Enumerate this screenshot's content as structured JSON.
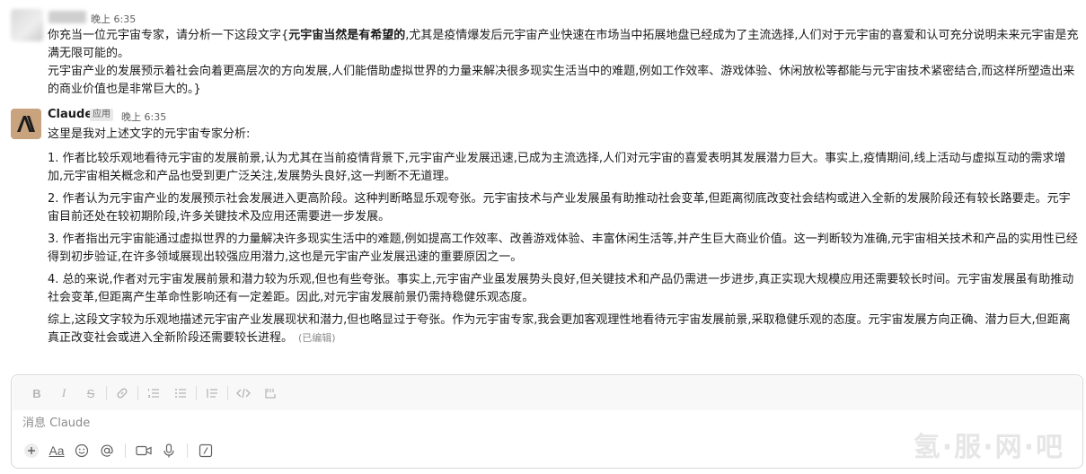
{
  "user_message": {
    "time": "晚上 6:35",
    "lines_intro": "你充当一位元宇宙专家，请分析一下这段文字{",
    "lines_bold": "元宇宙当然是有希望的",
    "lines_rest": ",尤其是疫情爆发后元宇宙产业快速在市场当中拓展地盘已经成为了主流选择,人们对于元宇宙的喜爱和认可充分说明未来元宇宙是充满无限可能的。",
    "paragraph2": "元宇宙产业的发展预示着社会向着更高层次的方向发展,人们能借助虚拟世界的力量来解决很多现实生活当中的难题,例如工作效率、游戏体验、休闲放松等都能与元宇宙技术紧密结合,而这样所塑造出来的商业价值也是非常巨大的。}"
  },
  "claude_message": {
    "author": "Claude",
    "badge": "应用",
    "time": "晚上 6:35",
    "intro": "这里是我对上述文字的元宇宙专家分析:",
    "points": [
      "1. 作者比较乐观地看待元宇宙的发展前景,认为尤其在当前疫情背景下,元宇宙产业发展迅速,已成为主流选择,人们对元宇宙的喜爱表明其发展潜力巨大。事实上,疫情期间,线上活动与虚拟互动的需求增加,元宇宙相关概念和产品也受到更广泛关注,发展势头良好,这一判断不无道理。",
      "2. 作者认为元宇宙产业的发展预示社会发展进入更高阶段。这种判断略显乐观夸张。元宇宙技术与产业发展虽有助推动社会变革,但距离彻底改变社会结构或进入全新的发展阶段还有较长路要走。元宇宙目前还处在较初期阶段,许多关键技术及应用还需要进一步发展。",
      "3. 作者指出元宇宙能通过虚拟世界的力量解决许多现实生活中的难题,例如提高工作效率、改善游戏体验、丰富休闲生活等,并产生巨大商业价值。这一判断较为准确,元宇宙相关技术和产品的实用性已经得到初步验证,在许多领域展现出较强应用潜力,这也是元宇宙产业发展迅速的重要原因之一。",
      "4. 总的来说,作者对元宇宙发展前景和潜力较为乐观,但也有些夸张。事实上,元宇宙产业虽发展势头良好,但关键技术和产品仍需进一步进步,真正实现大规模应用还需要较长时间。元宇宙发展虽有助推动社会变革,但距离产生革命性影响还有一定差距。因此,对元宇宙发展前景仍需持稳健乐观态度。"
    ],
    "conclusion": "综上,这段文字较为乐观地描述元宇宙产业发展现状和潜力,但也略显过于夸张。作为元宇宙专家,我会更加客观理性地看待元宇宙发展前景,采取稳健乐观的态度。元宇宙发展方向正确、潜力巨大,但距离真正改变社会或进入全新阶段还需要较长进程。",
    "edited": "(已编辑)"
  },
  "composer": {
    "placeholder": "消息 Claude",
    "format_icons": [
      "bold-icon",
      "italic-icon",
      "strikethrough-icon",
      "link-icon",
      "ordered-list-icon",
      "bulleted-list-icon",
      "blockquote-icon",
      "code-icon",
      "code-block-icon"
    ],
    "bottom_icons": [
      "plus-icon",
      "text-format-icon",
      "emoji-icon",
      "mention-icon",
      "video-icon",
      "microphone-icon",
      "slash-command-icon"
    ],
    "format_glyphs": {
      "bold": "B",
      "italic": "I",
      "strike": "S",
      "aa": "Aa"
    },
    "watermark": "氢·服·网·吧"
  }
}
